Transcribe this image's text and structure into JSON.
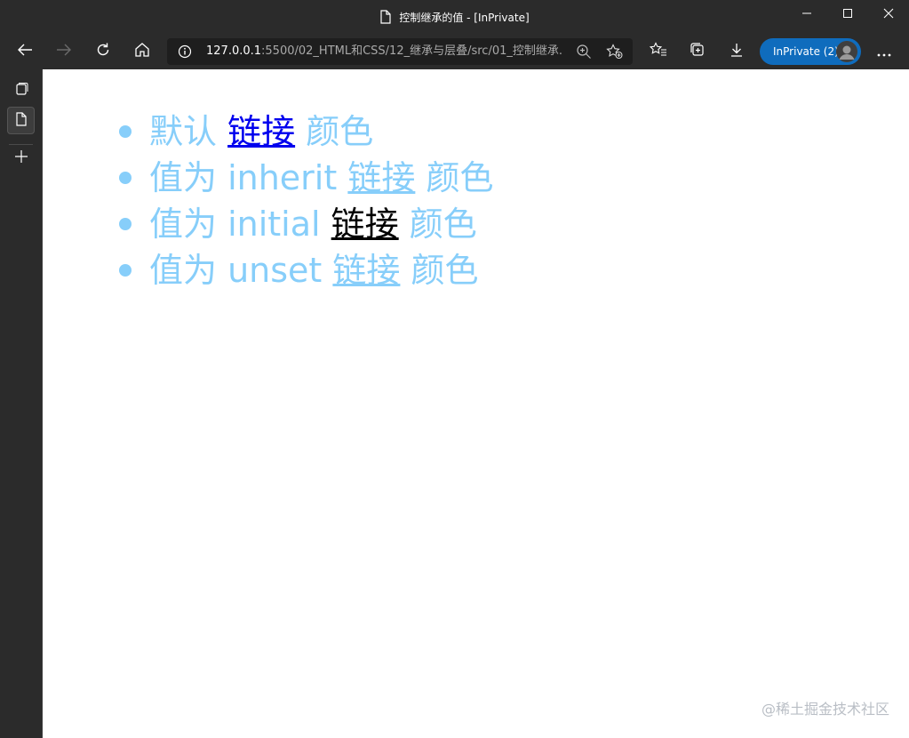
{
  "window": {
    "title": "控制继承的值 - [InPrivate]"
  },
  "toolbar": {
    "address_host": "127.0.0.1",
    "address_path": ":5500/02_HTML和CSS/12_继承与层叠/src/01_控制继承...",
    "inprivate_label": "InPrivate (2)"
  },
  "page": {
    "items": [
      {
        "before": "默认 ",
        "link": "链接",
        "after": " 颜色"
      },
      {
        "before": "值为 inherit ",
        "link": "链接",
        "after": " 颜色"
      },
      {
        "before": "值为 initial ",
        "link": "链接",
        "after": " 颜色"
      },
      {
        "before": "值为 unset ",
        "link": "链接",
        "after": " 颜色"
      }
    ],
    "text_color": "#87cefa",
    "default_link_color": "#0000ee",
    "initial_link_color": "#000000"
  },
  "watermark": "@稀土掘金技术社区",
  "icons": {
    "titlebar": [
      "page-icon",
      "minimize-icon",
      "maximize-icon",
      "close-icon"
    ],
    "toolbar": [
      "back-icon",
      "forward-icon",
      "refresh-icon",
      "home-icon",
      "info-icon",
      "zoom-icon",
      "add-favorite-icon",
      "favorites-icon",
      "collections-icon",
      "downloads-icon",
      "more-icon"
    ],
    "sidebar": [
      "tab-actions-icon",
      "vertical-tab-page-icon",
      "new-tab-icon"
    ]
  }
}
